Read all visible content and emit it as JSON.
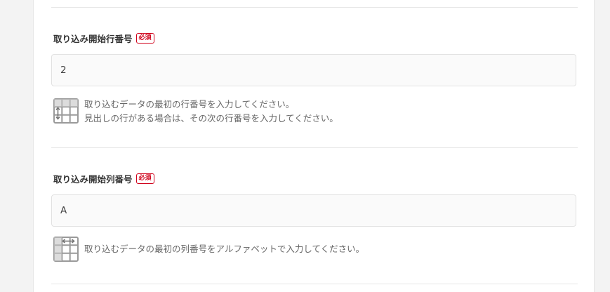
{
  "fields": [
    {
      "label": "取り込み開始行番号",
      "required_badge": "必須",
      "value": "2",
      "help_icon": "table-rows-icon",
      "help_lines": [
        "取り込むデータの最初の行番号を入力してください。",
        "見出しの行がある場合は、その次の行番号を入力してください。"
      ]
    },
    {
      "label": "取り込み開始列番号",
      "required_badge": "必須",
      "value": "A",
      "help_icon": "table-columns-icon",
      "help_lines": [
        "取り込むデータの最初の列番号をアルファベットで入力してください。"
      ]
    }
  ],
  "colors": {
    "required": "#d0021b",
    "icon": "#9a9a9a",
    "background": "#f3f3f3"
  }
}
